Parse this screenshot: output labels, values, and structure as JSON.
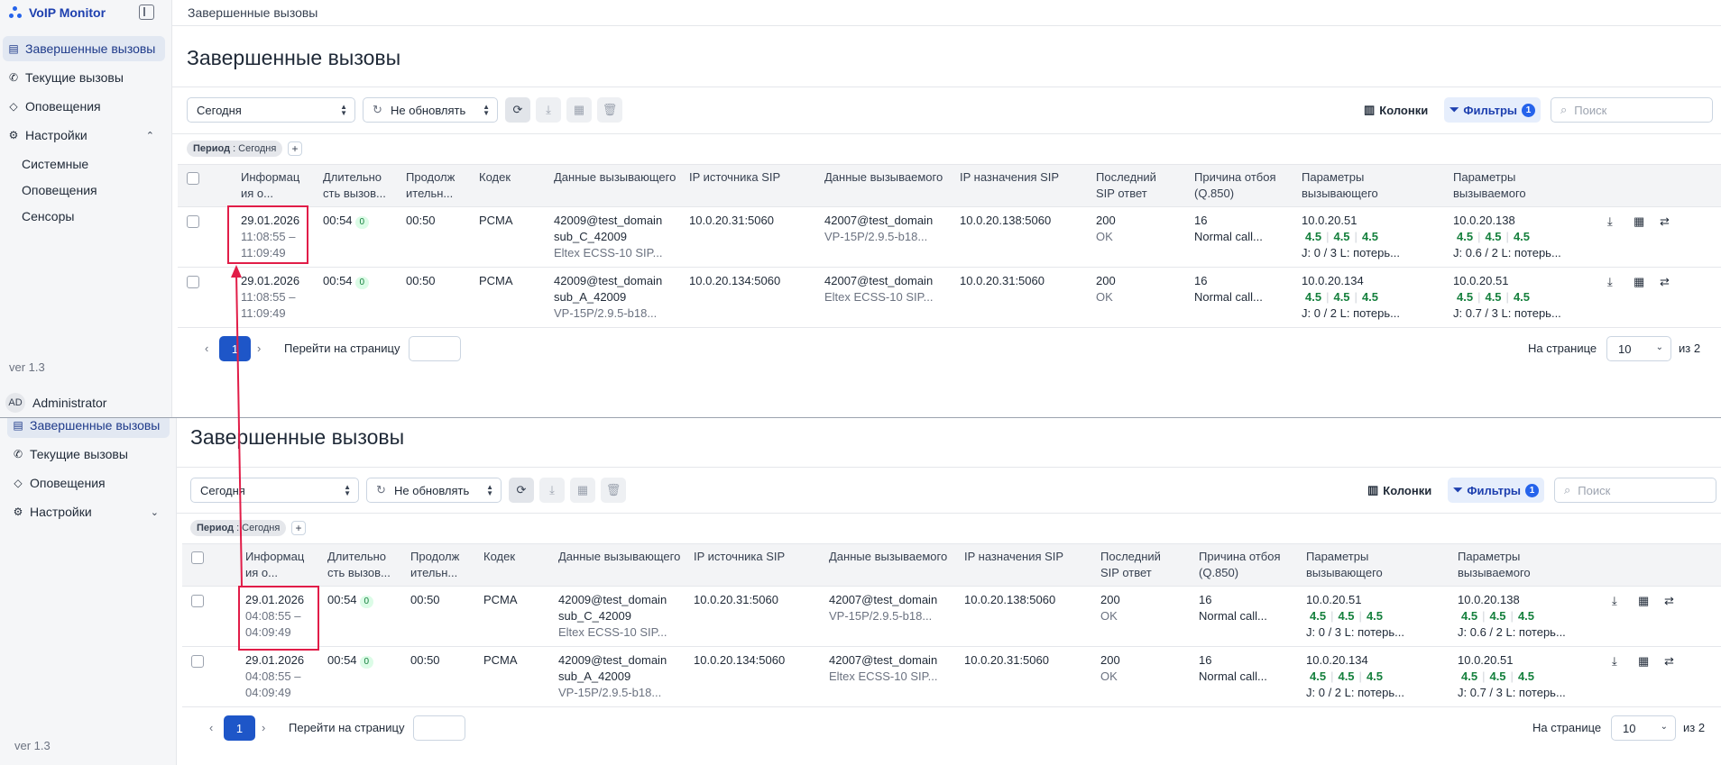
{
  "app": {
    "title": "VoIP Monitor",
    "version": "ver 1.3",
    "user": {
      "initials": "AD",
      "name": "Administrator"
    }
  },
  "nav": {
    "completed": "Завершенные вызовы",
    "current": "Текущие вызовы",
    "alerts": "Оповещения",
    "settings": "Настройки",
    "sub": [
      "Системные",
      "Оповещения",
      "Сенсоры"
    ]
  },
  "breadcrumb": "Завершенные вызовы",
  "page_title": "Завершенные вызовы",
  "toolbar": {
    "period_select": "Сегодня",
    "refresh_select": "Не обновлять",
    "columns_label": "Колонки",
    "filters_label": "Фильтры",
    "filters_count": "1",
    "search_placeholder": "Поиск"
  },
  "filter_chip": {
    "key": "Период",
    "value": ": Сегодня",
    "add": "+"
  },
  "columns": [
    "Информац ия о...",
    "Длительно сть вызов...",
    "Продолж ительн...",
    "Кодек",
    "Данные вызывающего",
    "IP источника SIP",
    "Данные вызываемого",
    "IP назначения SIP",
    "Последний SIP ответ",
    "Причина отбоя (Q.850)",
    "Параметры вызывающего",
    "Параметры вызываемого"
  ],
  "top_rows": [
    {
      "date": "29.01.2026",
      "time_start": "11:08:55 –",
      "time_end": "11:09:49",
      "duration": "00:54",
      "duration_badge": "0",
      "talk": "00:50",
      "codec": "PCMA",
      "caller": "42009@test_domain",
      "caller_sub": "sub_C_42009",
      "caller_dev": "Eltex ECSS-10 SIP...",
      "src_ip": "10.0.20.31:5060",
      "callee": "42007@test_domain",
      "callee_dev": "VP-15P/2.9.5-b18...",
      "dst_ip": "10.0.20.138:5060",
      "sip_code": "200",
      "sip_text": "OK",
      "q850_code": "16",
      "q850_text": "Normal call...",
      "caller_ip": "10.0.20.51",
      "caller_mos": [
        "4.5",
        "4.5",
        "4.5"
      ],
      "caller_jl": "J: 0 / 3  L:  потерь...",
      "callee_ip": "10.0.20.138",
      "callee_mos": [
        "4.5",
        "4.5",
        "4.5"
      ],
      "callee_jl": "J: 0.6 / 2  L:  потерь..."
    },
    {
      "date": "29.01.2026",
      "time_start": "11:08:55 –",
      "time_end": "11:09:49",
      "duration": "00:54",
      "duration_badge": "0",
      "talk": "00:50",
      "codec": "PCMA",
      "caller": "42009@test_domain",
      "caller_sub": "sub_A_42009",
      "caller_dev": "VP-15P/2.9.5-b18...",
      "src_ip": "10.0.20.134:5060",
      "callee": "42007@test_domain",
      "callee_dev": "Eltex ECSS-10 SIP...",
      "dst_ip": "10.0.20.31:5060",
      "sip_code": "200",
      "sip_text": "OK",
      "q850_code": "16",
      "q850_text": "Normal call...",
      "caller_ip": "10.0.20.134",
      "caller_mos": [
        "4.5",
        "4.5",
        "4.5"
      ],
      "caller_jl": "J: 0 / 2  L:  потерь...",
      "callee_ip": "10.0.20.51",
      "callee_mos": [
        "4.5",
        "4.5",
        "4.5"
      ],
      "callee_jl": "J: 0.7 / 3  L:  потерь..."
    }
  ],
  "bottom_rows": [
    {
      "date": "29.01.2026",
      "time_start": "04:08:55 –",
      "time_end": "04:09:49",
      "duration": "00:54",
      "duration_badge": "0",
      "talk": "00:50",
      "codec": "PCMA",
      "caller": "42009@test_domain",
      "caller_sub": "sub_C_42009",
      "caller_dev": "Eltex ECSS-10 SIP...",
      "src_ip": "10.0.20.31:5060",
      "callee": "42007@test_domain",
      "callee_dev": "VP-15P/2.9.5-b18...",
      "dst_ip": "10.0.20.138:5060",
      "sip_code": "200",
      "sip_text": "OK",
      "q850_code": "16",
      "q850_text": "Normal call...",
      "caller_ip": "10.0.20.51",
      "caller_mos": [
        "4.5",
        "4.5",
        "4.5"
      ],
      "caller_jl": "J: 0 / 3  L:  потерь...",
      "callee_ip": "10.0.20.138",
      "callee_mos": [
        "4.5",
        "4.5",
        "4.5"
      ],
      "callee_jl": "J: 0.6 / 2  L:  потерь..."
    },
    {
      "date": "29.01.2026",
      "time_start": "04:08:55 –",
      "time_end": "04:09:49",
      "duration": "00:54",
      "duration_badge": "0",
      "talk": "00:50",
      "codec": "PCMA",
      "caller": "42009@test_domain",
      "caller_sub": "sub_A_42009",
      "caller_dev": "VP-15P/2.9.5-b18...",
      "src_ip": "10.0.20.134:5060",
      "callee": "42007@test_domain",
      "callee_dev": "Eltex ECSS-10 SIP...",
      "dst_ip": "10.0.20.31:5060",
      "sip_code": "200",
      "sip_text": "OK",
      "q850_code": "16",
      "q850_text": "Normal call...",
      "caller_ip": "10.0.20.134",
      "caller_mos": [
        "4.5",
        "4.5",
        "4.5"
      ],
      "caller_jl": "J: 0 / 2  L:  потерь...",
      "callee_ip": "10.0.20.51",
      "callee_mos": [
        "4.5",
        "4.5",
        "4.5"
      ],
      "callee_jl": "J: 0.7 / 3  L:  потерь..."
    }
  ],
  "pagination": {
    "current_page": "1",
    "goto_label": "Перейти на страницу",
    "per_page_label": "На странице",
    "per_page_value": "10",
    "of_label": "из 2"
  },
  "annotation": {
    "color": "#e11d48"
  }
}
